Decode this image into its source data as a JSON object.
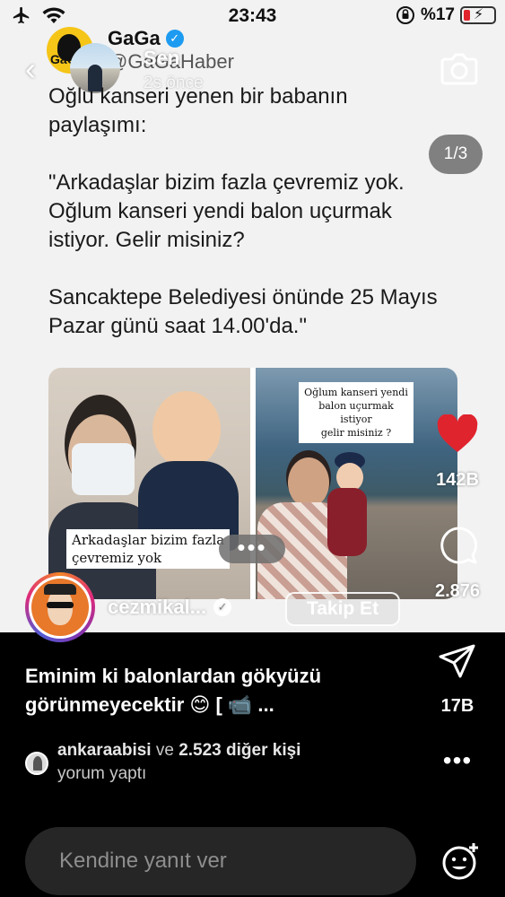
{
  "status_bar": {
    "time": "23:43",
    "battery": "%17"
  },
  "story_header": {
    "user": "Sen",
    "time_ago": "2s önce"
  },
  "tweet": {
    "account_name": "GaGa",
    "handle": "@GaGaHaber",
    "logo_text": "GaGa",
    "paragraphs": [
      "Oğlu kanseri yenen bir babanın paylaşımı:",
      "\"Arkadaşlar bizim fazla çevremiz yok. Oğlum kanseri yendi balon uçurmak istiyor. Gelir misiniz?",
      "Sancaktepe Belediyesi önünde 25 Mayıs Pazar günü saat 14.00'da.\""
    ],
    "image_left_caption": "Arkadaşlar bizim fazla\nçevremiz yok",
    "image_right_caption": "Oğlum kanseri yendi\nbalon uçurmak istiyor\ngelir misiniz ?"
  },
  "page_counter": "1/3",
  "more_dots": "•••",
  "side_actions": {
    "likes": "142B",
    "comments": "2.876",
    "shares": "17B"
  },
  "author": {
    "username": "cezmikal...",
    "follow_label": "Takip Et"
  },
  "caption": "Eminim ki balonlardan gökyüzü\ngörünmeyecektir 😊 [ 📹 ...",
  "activity": {
    "user": "ankaraabisi",
    "connector": " ve ",
    "others": "2.523 diğer kişi",
    "action": "yorum yaptı"
  },
  "reply": {
    "placeholder": "Kendine yanıt ver"
  },
  "colors": {
    "like_red": "#e0242e",
    "verified_blue": "#1d9bf0",
    "background_dark": "#000000"
  }
}
